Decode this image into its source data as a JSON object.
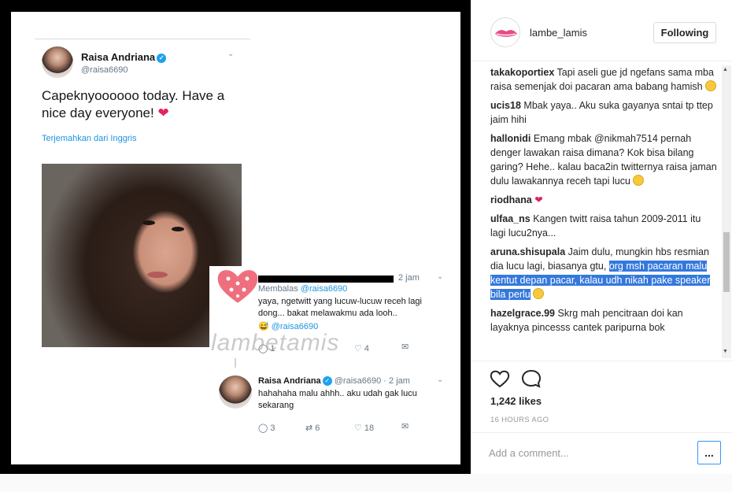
{
  "post_image": {
    "tweet": {
      "name": "Raisa Andriana",
      "handle": "@raisa6690",
      "text": "Capeknyoooooo today. Have a nice day everyone!",
      "translate_label": "Terjemahkan dari Inggris"
    },
    "reply1": {
      "time": "2 jam",
      "replying_prefix": "Membalas",
      "replying_to": "@raisa6690",
      "text": "yaya, ngetwitt yang lucuw-lucuw receh lagi dong... bakat melawakmu ada looh..",
      "mention": "@raisa6690",
      "counts": {
        "reply": "1",
        "like": "4"
      }
    },
    "reply2": {
      "name": "Raisa Andriana",
      "handle": "@raisa6690",
      "time": "· 2 jam",
      "text": "hahahaha malu ahhh.. aku udah gak lucu sekarang",
      "counts": {
        "reply": "3",
        "retweet": "6",
        "like": "18"
      }
    },
    "watermark": "lambetamis"
  },
  "header": {
    "username": "lambe_lamis",
    "follow_label": "Following"
  },
  "comments": [
    {
      "user": "takakoportiex",
      "text": "Tapi aseli gue jd ngefans sama mba raisa semenjak doi pacaran ama babang hamish",
      "emoji": true
    },
    {
      "user": "ucis18",
      "text": "Mbak yaya.. Aku suka gayanya sntai tp ttep jaim hihi",
      "emoji": false
    },
    {
      "user": "hallonidi",
      "text": "Emang mbak @nikmah7514 pernah denger lawakan raisa dimana? Kok bisa bilang garing? Hehe.. kalau baca2in twitternya raisa jaman dulu lawakannya receh tapi lucu",
      "emoji": true
    },
    {
      "user": "riodhana",
      "text": "",
      "emoji": false
    },
    {
      "user": "ulfaa_ns",
      "text": "Kangen twitt raisa tahun 2009-2011 itu lagi lucu2nya...",
      "emoji": false
    },
    {
      "user": "aruna.shisupala",
      "text": "Jaim dulu, mungkin hbs resmian dia lucu lagi, biasanya gtu,",
      "selected": "org msh pacaran malu kentut depan pacar, kalau udh nikah pake speaker bila perlu",
      "emoji": true
    },
    {
      "user": "hazelgrace.99",
      "text": "Skrg mah pencitraan doi kan layaknya pincesss cantek paripurna bok",
      "emoji": false
    }
  ],
  "likes": "1,242 likes",
  "time_ago": "16 HOURS AGO",
  "comment_placeholder": "Add a comment...",
  "more_label": "...",
  "colors": {
    "accent": "#3897f0",
    "selection": "#3478dd",
    "twitter_blue": "#1da1f2"
  }
}
